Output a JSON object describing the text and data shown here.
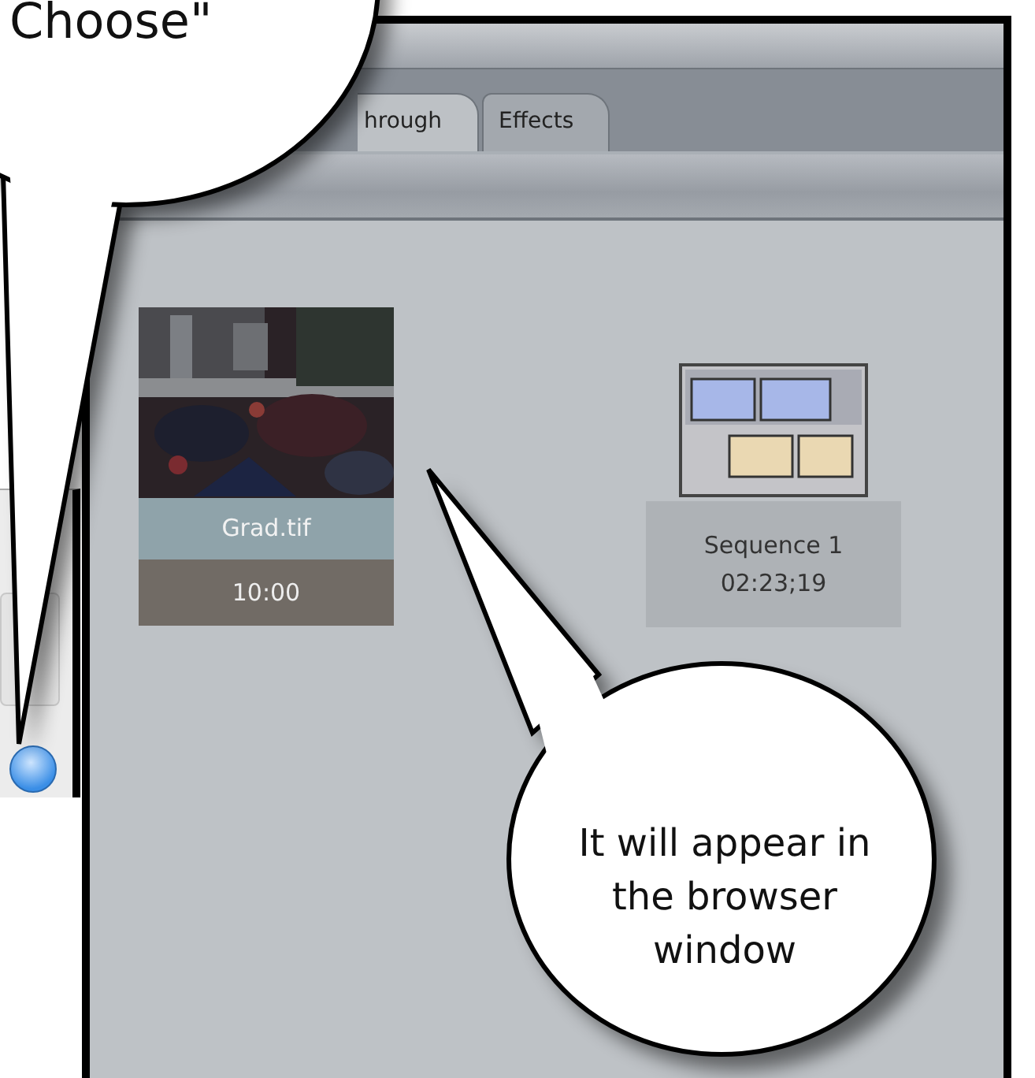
{
  "tabs": [
    {
      "label": "hrough",
      "selected": true
    },
    {
      "label": "Effects",
      "selected": false
    }
  ],
  "items": [
    {
      "kind": "clip",
      "name": "Grad.tif",
      "duration": "10:00"
    },
    {
      "kind": "sequence",
      "name": "Sequence 1",
      "duration": "02:23;19"
    }
  ],
  "callouts": [
    {
      "text": "Choose\""
    },
    {
      "text": "It will appear in the browser window"
    }
  ]
}
